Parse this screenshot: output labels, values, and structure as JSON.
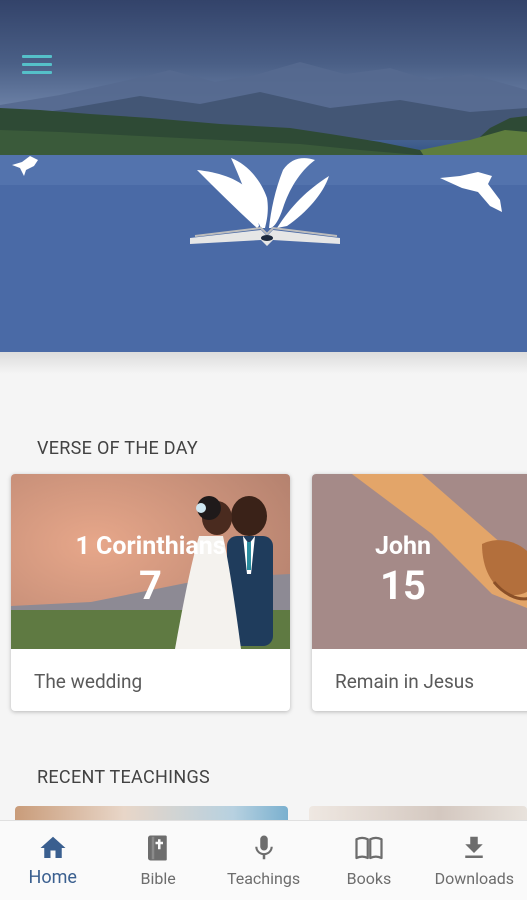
{
  "header": {
    "menu_icon": "hamburger-menu-icon",
    "logo_icon": "open-bible-with-dove-icon"
  },
  "verse_section": {
    "title": "VERSE OF THE DAY",
    "cards": [
      {
        "book": "1 Corinthians",
        "chapter": "7",
        "caption": "The wedding"
      },
      {
        "book": "John",
        "chapter": "15",
        "caption": "Remain in Jesus"
      }
    ]
  },
  "teachings_section": {
    "title": "RECENT TEACHINGS"
  },
  "nav": {
    "active": "Home",
    "items": [
      {
        "label": "Home",
        "icon": "home-icon"
      },
      {
        "label": "Bible",
        "icon": "bible-icon"
      },
      {
        "label": "Teachings",
        "icon": "microphone-icon"
      },
      {
        "label": "Books",
        "icon": "open-book-icon"
      },
      {
        "label": "Downloads",
        "icon": "download-icon"
      }
    ]
  },
  "colors": {
    "accent": "#3a5f8f",
    "menu": "#55c0c9",
    "hero_blue": "#4767a3"
  }
}
